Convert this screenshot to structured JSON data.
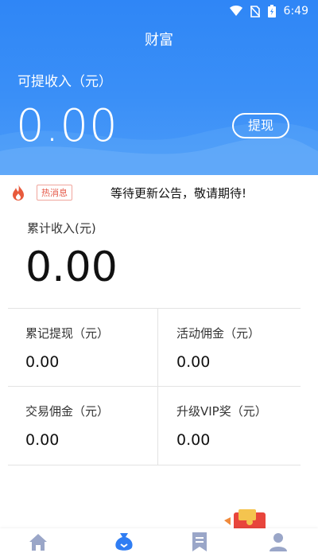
{
  "status_bar": {
    "time": "6:49"
  },
  "header": {
    "title": "财富",
    "withdrawable_label": "可提收入（元）",
    "withdrawable_amount": "0.00",
    "withdraw_button": "提现"
  },
  "notice": {
    "tag": "热消息",
    "text": "等待更新公告，敬请期待!"
  },
  "cumulative": {
    "label": "累计收入(元)",
    "amount": "0.00"
  },
  "stats": [
    {
      "label": "累记提现（元）",
      "value": "0.00"
    },
    {
      "label": "活动佣金（元）",
      "value": "0.00"
    },
    {
      "label": "交易佣金（元）",
      "value": "0.00"
    },
    {
      "label": "升级VIP奖（元）",
      "value": "0.00"
    }
  ],
  "colors": {
    "primary_blue": "#3a8ff7",
    "nav_inactive": "#9aa6c8",
    "hot_red": "#e55a4a"
  },
  "bottom_nav": [
    {
      "icon": "home-icon",
      "active": false
    },
    {
      "icon": "wealth-bag-icon",
      "active": true
    },
    {
      "icon": "bookmark-icon",
      "active": false
    },
    {
      "icon": "user-icon",
      "active": false
    }
  ]
}
